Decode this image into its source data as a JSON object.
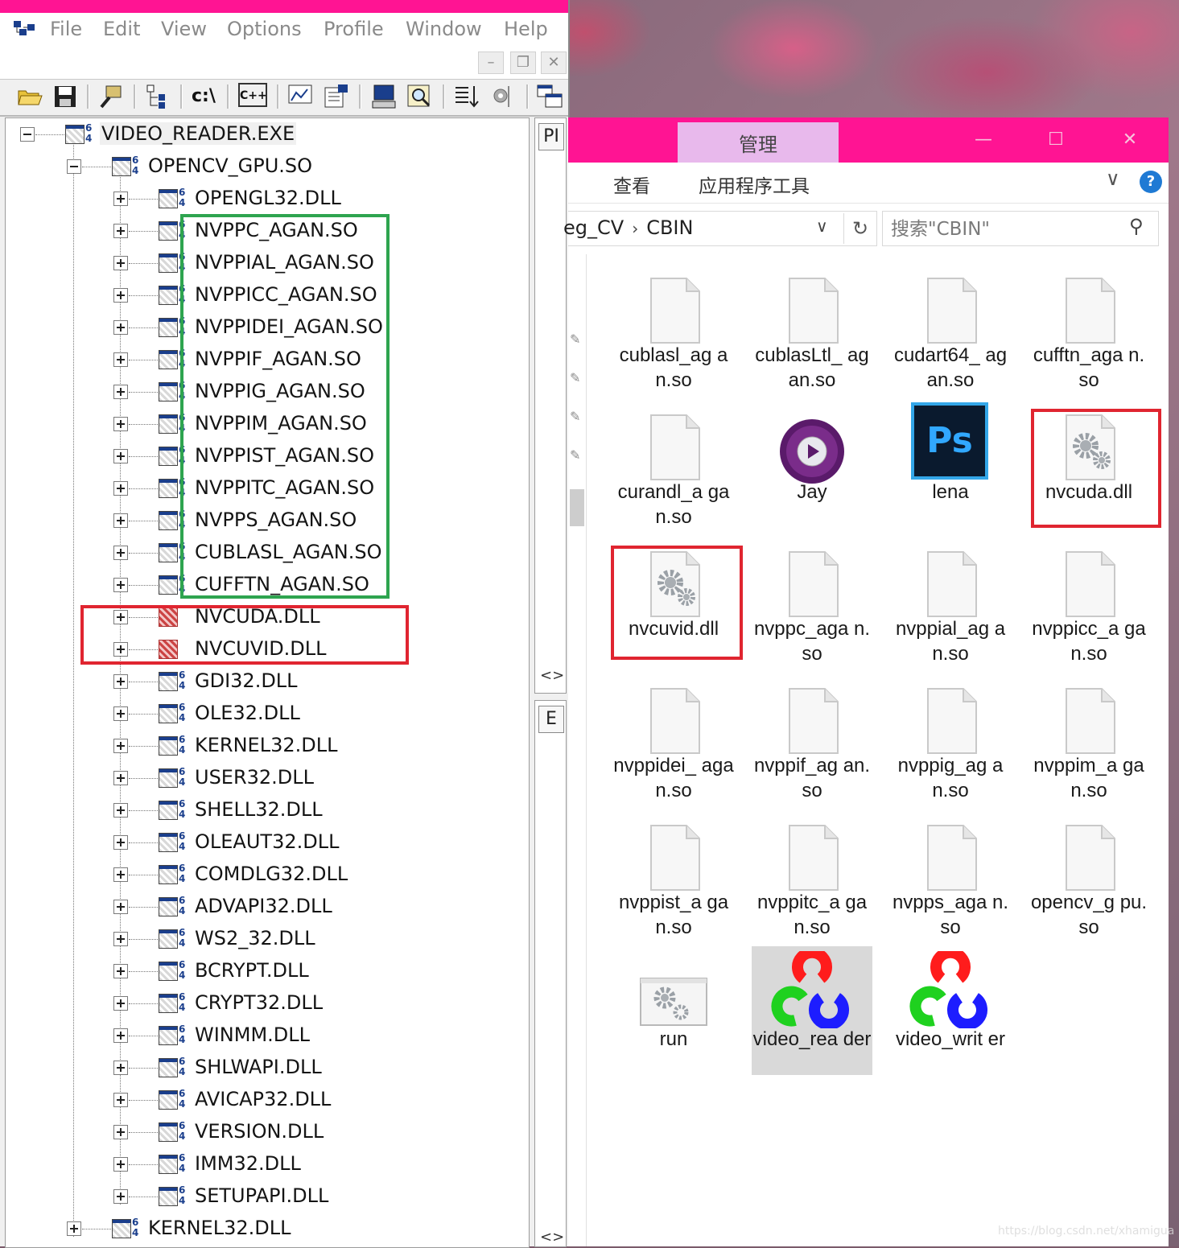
{
  "menu": [
    "File",
    "Edit",
    "View",
    "Options",
    "Profile",
    "Window",
    "Help"
  ],
  "mdi_controls": [
    "–",
    "❐",
    "✕"
  ],
  "toolbar_icons": [
    "open-folder-icon",
    "save-icon",
    "find-icon",
    "tree-expand-icon",
    "console-icon",
    "cplusplus-icon",
    "chart-icon",
    "properties-icon",
    "computer-icon",
    "magnifier-icon",
    "sort-icon",
    "gears-icon",
    "windows-icon"
  ],
  "toolbar_text": {
    "console": "c:\\",
    "cpp": "C++"
  },
  "tree": {
    "root": "VIDEO_READER.EXE",
    "level1": "OPENCV_GPU.SO",
    "children": [
      "OPENGL32.DLL",
      "NVPPC_AGAN.SO",
      "NVPPIAL_AGAN.SO",
      "NVPPICC_AGAN.SO",
      "NVPPIDEI_AGAN.SO",
      "NVPPIF_AGAN.SO",
      "NVPPIG_AGAN.SO",
      "NVPPIM_AGAN.SO",
      "NVPPIST_AGAN.SO",
      "NVPPITC_AGAN.SO",
      "NVPPS_AGAN.SO",
      "CUBLASL_AGAN.SO",
      "CUFFTN_AGAN.SO",
      "NVCUDA.DLL",
      "NVCUVID.DLL",
      "GDI32.DLL",
      "OLE32.DLL",
      "KERNEL32.DLL",
      "USER32.DLL",
      "SHELL32.DLL",
      "OLEAUT32.DLL",
      "COMDLG32.DLL",
      "ADVAPI32.DLL",
      "WS2_32.DLL",
      "BCRYPT.DLL",
      "CRYPT32.DLL",
      "WINMM.DLL",
      "SHLWAPI.DLL",
      "AVICAP32.DLL",
      "VERSION.DLL",
      "IMM32.DLL",
      "SETUPAPI.DLL"
    ],
    "missing": [
      "NVCUDA.DLL",
      "NVCUVID.DLL"
    ],
    "last_root_child": "KERNEL32.DLL"
  },
  "side": {
    "tab1": "PI",
    "tab2": "E",
    "arrows": "<>"
  },
  "explorer": {
    "manage_tab": "管理",
    "ribbon_tabs": [
      "查看",
      "应用程序工具"
    ],
    "window_controls": [
      "—",
      "☐",
      "✕"
    ],
    "help": "?",
    "breadcrumb": [
      "eg_CV",
      "CBIN"
    ],
    "search_placeholder": "搜索\"CBIN\"",
    "files": [
      {
        "name": "cublasl_ag an.so",
        "icon": "blank-file-icon"
      },
      {
        "name": "cublasLtl_ agan.so",
        "icon": "blank-file-icon"
      },
      {
        "name": "cudart64_ agan.so",
        "icon": "blank-file-icon"
      },
      {
        "name": "cufftn_aga n.so",
        "icon": "blank-file-icon"
      },
      {
        "name": "curandl_a gan.so",
        "icon": "blank-file-icon"
      },
      {
        "name": "Jay",
        "icon": "media-player-icon"
      },
      {
        "name": "lena",
        "icon": "photoshop-icon"
      },
      {
        "name": "nvcuda.dll",
        "icon": "dll-gear-icon"
      },
      {
        "name": "nvcuvid.dll",
        "icon": "dll-gear-icon"
      },
      {
        "name": "nvppc_aga n.so",
        "icon": "blank-file-icon"
      },
      {
        "name": "nvppial_ag an.so",
        "icon": "blank-file-icon"
      },
      {
        "name": "nvppicc_a gan.so",
        "icon": "blank-file-icon"
      },
      {
        "name": "nvppidei_ agan.so",
        "icon": "blank-file-icon"
      },
      {
        "name": "nvppif_ag an.so",
        "icon": "blank-file-icon"
      },
      {
        "name": "nvppig_ag an.so",
        "icon": "blank-file-icon"
      },
      {
        "name": "nvppim_a gan.so",
        "icon": "blank-file-icon"
      },
      {
        "name": "nvppist_a gan.so",
        "icon": "blank-file-icon"
      },
      {
        "name": "nvppitc_a gan.so",
        "icon": "blank-file-icon"
      },
      {
        "name": "nvpps_aga n.so",
        "icon": "blank-file-icon"
      },
      {
        "name": "opencv_g pu.so",
        "icon": "blank-file-icon"
      },
      {
        "name": "run",
        "icon": "exe-gear-icon"
      },
      {
        "name": "video_rea der",
        "icon": "opencv-logo-icon"
      },
      {
        "name": "video_writ er",
        "icon": "opencv-logo-icon"
      }
    ],
    "selected_file": "video_rea der",
    "highlighted_files": [
      "nvcuda.dll",
      "nvcuvid.dll"
    ]
  },
  "ps_label": "Ps",
  "watermark": "https://blog.csdn.net/xhamigua",
  "colors": {
    "titlebar": "#ff1493",
    "manage_tab": "#e8b9ec",
    "green_box": "#2ea44f",
    "red_box": "#e02530",
    "help": "#1f7ad4"
  }
}
